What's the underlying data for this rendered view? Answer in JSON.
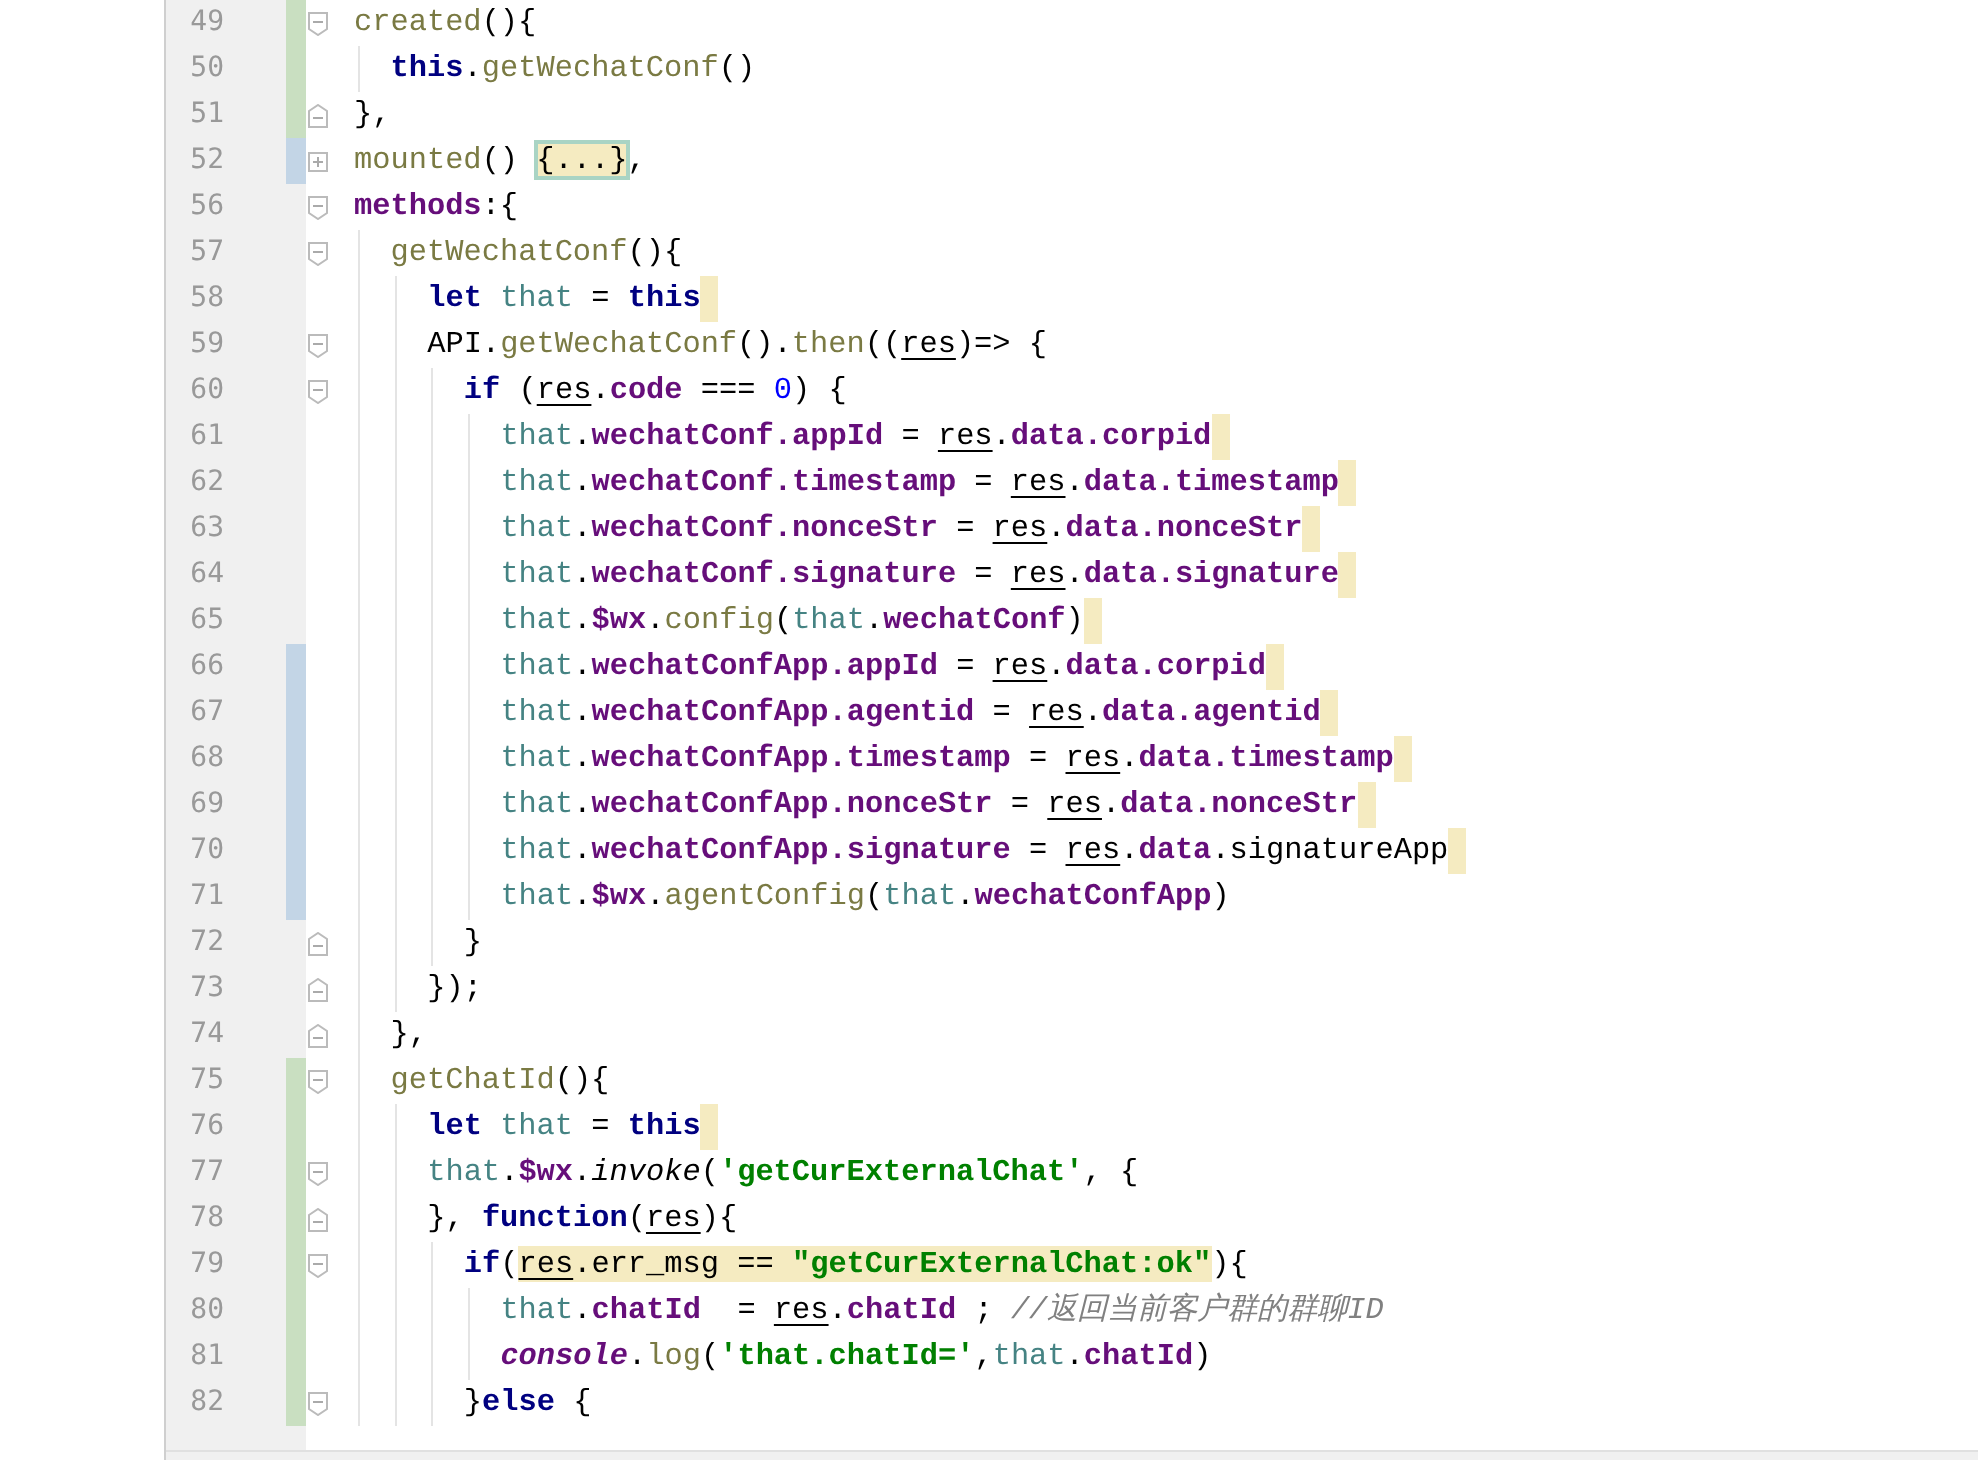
{
  "editor": {
    "lines": [
      {
        "number": "49",
        "color": "#c9dfc1",
        "kind": "open",
        "trail": false,
        "tokens": [
          {
            "text": "created",
            "kind": "fn"
          },
          {
            "text": "(){",
            "kind": "plain"
          }
        ],
        "children": [
          {
            "number": "50",
            "color": "#c9dfc1",
            "trail": false,
            "tokens": [
              {
                "text": "this",
                "kind": "kw"
              },
              {
                "text": ".",
                "kind": "plain"
              },
              {
                "text": "getWechatConf",
                "kind": "fn"
              },
              {
                "text": "()",
                "kind": "plain"
              }
            ]
          }
        ]
      },
      {
        "number": "51",
        "color": "#c9dfc1",
        "kind": "close",
        "trail": false,
        "tokens": [
          {
            "text": "},",
            "kind": "plain"
          }
        ]
      },
      {
        "number": "52",
        "color": "#c3d5e6",
        "kind": "folded",
        "trail": false,
        "tokens": [
          {
            "text": "mounted",
            "kind": "fn"
          },
          {
            "text": "() ",
            "kind": "plain"
          },
          {
            "text": "{...}",
            "kind": "folded"
          },
          {
            "text": ",",
            "kind": "plain"
          }
        ]
      },
      {
        "number": "56",
        "kind": "open",
        "trail": false,
        "tokens": [
          {
            "text": "methods",
            "kind": "prop"
          },
          {
            "text": ":{",
            "kind": "plain"
          }
        ],
        "children": [
          {
            "number": "57",
            "kind": "open",
            "trail": false,
            "tokens": [
              {
                "text": "getWechatConf",
                "kind": "fn"
              },
              {
                "text": "(){",
                "kind": "plain"
              }
            ],
            "children": [
              {
                "number": "58",
                "trail": true,
                "tokens": [
                  {
                    "text": "let ",
                    "kind": "kw"
                  },
                  {
                    "text": "that",
                    "kind": "local"
                  },
                  {
                    "text": " = ",
                    "kind": "plain"
                  },
                  {
                    "text": "this",
                    "kind": "kw"
                  }
                ]
              },
              {
                "number": "59",
                "kind": "open",
                "trail": false,
                "tokens": [
                  {
                    "text": "API.",
                    "kind": "plain"
                  },
                  {
                    "text": "getWechatConf",
                    "kind": "fn"
                  },
                  {
                    "text": "().",
                    "kind": "plain"
                  },
                  {
                    "text": "then",
                    "kind": "fn"
                  },
                  {
                    "text": "((",
                    "kind": "plain"
                  },
                  {
                    "text": "res",
                    "kind": "param"
                  },
                  {
                    "text": ")=> {",
                    "kind": "plain"
                  }
                ],
                "children": [
                  {
                    "number": "60",
                    "kind": "open",
                    "trail": false,
                    "tokens": [
                      {
                        "text": "if",
                        "kind": "kw"
                      },
                      {
                        "text": " (",
                        "kind": "plain"
                      },
                      {
                        "text": "res",
                        "kind": "param"
                      },
                      {
                        "text": ".",
                        "kind": "plain"
                      },
                      {
                        "text": "code",
                        "kind": "prop"
                      },
                      {
                        "text": " === ",
                        "kind": "plain"
                      },
                      {
                        "text": "0",
                        "kind": "num"
                      },
                      {
                        "text": ") {",
                        "kind": "plain"
                      }
                    ],
                    "children": [
                      {
                        "number": "61",
                        "trail": true,
                        "tokens": [
                          {
                            "text": "that",
                            "kind": "local"
                          },
                          {
                            "text": ".",
                            "kind": "plain"
                          },
                          {
                            "text": "wechatConf.appId",
                            "kind": "prop"
                          },
                          {
                            "text": " = ",
                            "kind": "plain"
                          },
                          {
                            "text": "res",
                            "kind": "param"
                          },
                          {
                            "text": ".",
                            "kind": "plain"
                          },
                          {
                            "text": "data.corpid",
                            "kind": "prop"
                          }
                        ]
                      },
                      {
                        "number": "62",
                        "trail": true,
                        "tokens": [
                          {
                            "text": "that",
                            "kind": "local"
                          },
                          {
                            "text": ".",
                            "kind": "plain"
                          },
                          {
                            "text": "wechatConf.timestamp",
                            "kind": "prop"
                          },
                          {
                            "text": " = ",
                            "kind": "plain"
                          },
                          {
                            "text": "res",
                            "kind": "param"
                          },
                          {
                            "text": ".",
                            "kind": "plain"
                          },
                          {
                            "text": "data.timestamp",
                            "kind": "prop"
                          }
                        ]
                      },
                      {
                        "number": "63",
                        "trail": true,
                        "tokens": [
                          {
                            "text": "that",
                            "kind": "local"
                          },
                          {
                            "text": ".",
                            "kind": "plain"
                          },
                          {
                            "text": "wechatConf.nonceStr",
                            "kind": "prop"
                          },
                          {
                            "text": " = ",
                            "kind": "plain"
                          },
                          {
                            "text": "res",
                            "kind": "param"
                          },
                          {
                            "text": ".",
                            "kind": "plain"
                          },
                          {
                            "text": "data.nonceStr",
                            "kind": "prop"
                          }
                        ]
                      },
                      {
                        "number": "64",
                        "trail": true,
                        "tokens": [
                          {
                            "text": "that",
                            "kind": "local"
                          },
                          {
                            "text": ".",
                            "kind": "plain"
                          },
                          {
                            "text": "wechatConf.signature",
                            "kind": "prop"
                          },
                          {
                            "text": " = ",
                            "kind": "plain"
                          },
                          {
                            "text": "res",
                            "kind": "param"
                          },
                          {
                            "text": ".",
                            "kind": "plain"
                          },
                          {
                            "text": "data.signature",
                            "kind": "prop"
                          }
                        ]
                      },
                      {
                        "number": "65",
                        "trail": true,
                        "tokens": [
                          {
                            "text": "that",
                            "kind": "local"
                          },
                          {
                            "text": ".",
                            "kind": "plain"
                          },
                          {
                            "text": "$wx",
                            "kind": "prop"
                          },
                          {
                            "text": ".",
                            "kind": "plain"
                          },
                          {
                            "text": "config",
                            "kind": "fn"
                          },
                          {
                            "text": "(",
                            "kind": "plain"
                          },
                          {
                            "text": "that",
                            "kind": "local"
                          },
                          {
                            "text": ".",
                            "kind": "plain"
                          },
                          {
                            "text": "wechatConf",
                            "kind": "prop"
                          },
                          {
                            "text": ")",
                            "kind": "plain"
                          }
                        ]
                      },
                      {
                        "number": "66",
                        "color": "#c3d5e6",
                        "trail": true,
                        "tokens": [
                          {
                            "text": "that",
                            "kind": "local"
                          },
                          {
                            "text": ".",
                            "kind": "plain"
                          },
                          {
                            "text": "wechatConfApp.appId",
                            "kind": "prop"
                          },
                          {
                            "text": " = ",
                            "kind": "plain"
                          },
                          {
                            "text": "res",
                            "kind": "param"
                          },
                          {
                            "text": ".",
                            "kind": "plain"
                          },
                          {
                            "text": "data.corpid",
                            "kind": "prop"
                          }
                        ]
                      },
                      {
                        "number": "67",
                        "color": "#c3d5e6",
                        "trail": true,
                        "tokens": [
                          {
                            "text": "that",
                            "kind": "local"
                          },
                          {
                            "text": ".",
                            "kind": "plain"
                          },
                          {
                            "text": "wechatConfApp.agentid",
                            "kind": "prop"
                          },
                          {
                            "text": " = ",
                            "kind": "plain"
                          },
                          {
                            "text": "res",
                            "kind": "param"
                          },
                          {
                            "text": ".",
                            "kind": "plain"
                          },
                          {
                            "text": "data.agentid",
                            "kind": "prop"
                          }
                        ]
                      },
                      {
                        "number": "68",
                        "color": "#c3d5e6",
                        "trail": true,
                        "tokens": [
                          {
                            "text": "that",
                            "kind": "local"
                          },
                          {
                            "text": ".",
                            "kind": "plain"
                          },
                          {
                            "text": "wechatConfApp.timestamp",
                            "kind": "prop"
                          },
                          {
                            "text": " = ",
                            "kind": "plain"
                          },
                          {
                            "text": "res",
                            "kind": "param"
                          },
                          {
                            "text": ".",
                            "kind": "plain"
                          },
                          {
                            "text": "data.timestamp",
                            "kind": "prop"
                          }
                        ]
                      },
                      {
                        "number": "69",
                        "color": "#c3d5e6",
                        "trail": true,
                        "tokens": [
                          {
                            "text": "that",
                            "kind": "local"
                          },
                          {
                            "text": ".",
                            "kind": "plain"
                          },
                          {
                            "text": "wechatConfApp.nonceStr",
                            "kind": "prop"
                          },
                          {
                            "text": " = ",
                            "kind": "plain"
                          },
                          {
                            "text": "res",
                            "kind": "param"
                          },
                          {
                            "text": ".",
                            "kind": "plain"
                          },
                          {
                            "text": "data.nonceStr",
                            "kind": "prop"
                          }
                        ]
                      },
                      {
                        "number": "70",
                        "color": "#c3d5e6",
                        "trail": true,
                        "tokens": [
                          {
                            "text": "that",
                            "kind": "local"
                          },
                          {
                            "text": ".",
                            "kind": "plain"
                          },
                          {
                            "text": "wechatConfApp.signature",
                            "kind": "prop"
                          },
                          {
                            "text": " = ",
                            "kind": "plain"
                          },
                          {
                            "text": "res",
                            "kind": "param"
                          },
                          {
                            "text": ".",
                            "kind": "plain"
                          },
                          {
                            "text": "data",
                            "kind": "prop"
                          },
                          {
                            "text": ".signatureApp",
                            "kind": "plain"
                          }
                        ]
                      },
                      {
                        "number": "71",
                        "color": "#c3d5e6",
                        "trail": false,
                        "tokens": [
                          {
                            "text": "that",
                            "kind": "local"
                          },
                          {
                            "text": ".",
                            "kind": "plain"
                          },
                          {
                            "text": "$wx",
                            "kind": "prop"
                          },
                          {
                            "text": ".",
                            "kind": "plain"
                          },
                          {
                            "text": "agentConfig",
                            "kind": "fn"
                          },
                          {
                            "text": "(",
                            "kind": "plain"
                          },
                          {
                            "text": "that",
                            "kind": "local"
                          },
                          {
                            "text": ".",
                            "kind": "plain"
                          },
                          {
                            "text": "wechatConfApp",
                            "kind": "prop"
                          },
                          {
                            "text": ")",
                            "kind": "plain"
                          }
                        ]
                      }
                    ]
                  },
                  {
                    "number": "72",
                    "kind": "close",
                    "trail": false,
                    "tokens": [
                      {
                        "text": "}",
                        "kind": "plain"
                      }
                    ]
                  }
                ]
              },
              {
                "number": "73",
                "kind": "close",
                "trail": false,
                "tokens": [
                  {
                    "text": "});",
                    "kind": "plain"
                  }
                ]
              }
            ]
          },
          {
            "number": "74",
            "kind": "close",
            "trail": false,
            "tokens": [
              {
                "text": "},",
                "kind": "plain"
              }
            ]
          },
          {
            "number": "75",
            "color": "#c9dfc1",
            "kind": "open",
            "trail": false,
            "tokens": [
              {
                "text": "getChatId",
                "kind": "fn"
              },
              {
                "text": "(){",
                "kind": "plain"
              }
            ],
            "children": [
              {
                "number": "76",
                "color": "#c9dfc1",
                "trail": true,
                "tokens": [
                  {
                    "text": "let ",
                    "kind": "kw"
                  },
                  {
                    "text": "that",
                    "kind": "local"
                  },
                  {
                    "text": " = ",
                    "kind": "plain"
                  },
                  {
                    "text": "this",
                    "kind": "kw"
                  }
                ]
              },
              {
                "number": "77",
                "color": "#c9dfc1",
                "kind": "open",
                "trail": false,
                "tokens": [
                  {
                    "text": "that",
                    "kind": "local"
                  },
                  {
                    "text": ".",
                    "kind": "plain"
                  },
                  {
                    "text": "$wx",
                    "kind": "prop"
                  },
                  {
                    "text": ".",
                    "kind": "plain"
                  },
                  {
                    "text": "invoke",
                    "kind": "italic"
                  },
                  {
                    "text": "(",
                    "kind": "plain"
                  },
                  {
                    "text": "'getCurExternalChat'",
                    "kind": "str"
                  },
                  {
                    "text": ", {",
                    "kind": "plain"
                  }
                ]
              },
              {
                "number": "78",
                "color": "#c9dfc1",
                "kind": "close",
                "trail": false,
                "tokens": [
                  {
                    "text": "}, ",
                    "kind": "plain"
                  },
                  {
                    "text": "function",
                    "kind": "kw"
                  },
                  {
                    "text": "(",
                    "kind": "plain"
                  },
                  {
                    "text": "res",
                    "kind": "param"
                  },
                  {
                    "text": "){",
                    "kind": "plain"
                  }
                ],
                "children": [
                  {
                    "number": "79",
                    "color": "#c9dfc1",
                    "kind": "open",
                    "trail": false,
                    "tokens": [
                      {
                        "text": "if",
                        "kind": "kw"
                      },
                      {
                        "text": "(",
                        "kind": "plain"
                      },
                      {
                        "text": "res",
                        "kind": "param-hl"
                      },
                      {
                        "text": ".err_msg == ",
                        "kind": "plain-hl"
                      },
                      {
                        "text": "\"getCurExternalChat:ok\"",
                        "kind": "str-hl"
                      },
                      {
                        "text": "){",
                        "kind": "plain"
                      }
                    ],
                    "children": [
                      {
                        "number": "80",
                        "color": "#c9dfc1",
                        "trail": false,
                        "tokens": [
                          {
                            "text": "that",
                            "kind": "local"
                          },
                          {
                            "text": ".",
                            "kind": "plain"
                          },
                          {
                            "text": "chatId",
                            "kind": "prop"
                          },
                          {
                            "text": "  = ",
                            "kind": "plain"
                          },
                          {
                            "text": "res",
                            "kind": "param"
                          },
                          {
                            "text": ".",
                            "kind": "plain"
                          },
                          {
                            "text": "chatId",
                            "kind": "prop"
                          },
                          {
                            "text": " ; ",
                            "kind": "plain"
                          },
                          {
                            "text": "//返回当前客户群的群聊ID",
                            "kind": "comment"
                          }
                        ]
                      },
                      {
                        "number": "81",
                        "color": "#c9dfc1",
                        "trail": false,
                        "tokens": [
                          {
                            "text": "console",
                            "kind": "global"
                          },
                          {
                            "text": ".",
                            "kind": "plain"
                          },
                          {
                            "text": "log",
                            "kind": "fn"
                          },
                          {
                            "text": "(",
                            "kind": "plain"
                          },
                          {
                            "text": "'that.chatId='",
                            "kind": "str"
                          },
                          {
                            "text": ",",
                            "kind": "plain"
                          },
                          {
                            "text": "that",
                            "kind": "local"
                          },
                          {
                            "text": ".",
                            "kind": "plain"
                          },
                          {
                            "text": "chatId",
                            "kind": "prop"
                          },
                          {
                            "text": ")",
                            "kind": "plain"
                          }
                        ]
                      }
                    ]
                  },
                  {
                    "number": "82",
                    "color": "#c9dfc1",
                    "kind": "open",
                    "trail": false,
                    "tokens": [
                      {
                        "text": "}",
                        "kind": "plain"
                      },
                      {
                        "text": "else",
                        "kind": "kw"
                      },
                      {
                        "text": " {",
                        "kind": "plain"
                      }
                    ]
                  }
                ]
              }
            ]
          }
        ]
      }
    ]
  }
}
